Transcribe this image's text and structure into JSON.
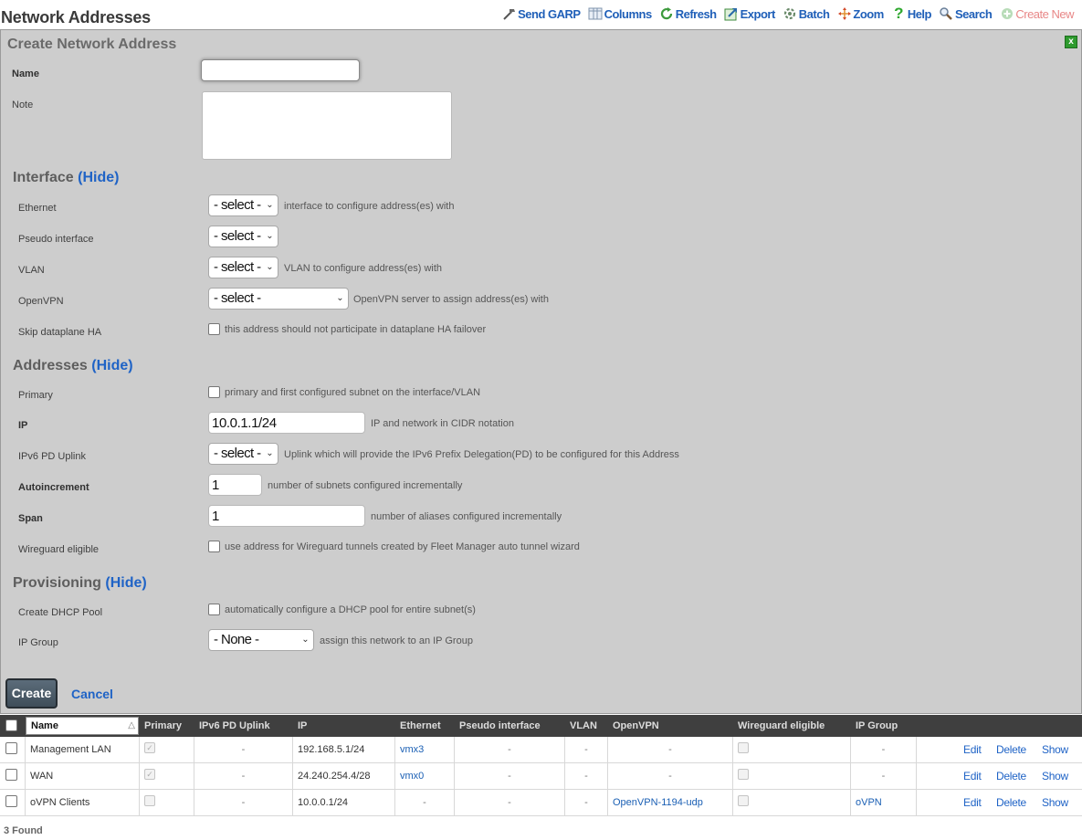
{
  "page": {
    "title": "Network Addresses"
  },
  "toolbar": [
    {
      "key": "send-garp",
      "label": "Send GARP",
      "icon": "hammer-icon",
      "enabled": true
    },
    {
      "key": "columns",
      "label": "Columns",
      "icon": "columns-icon",
      "enabled": true
    },
    {
      "key": "refresh",
      "label": "Refresh",
      "icon": "refresh-icon",
      "enabled": true
    },
    {
      "key": "export",
      "label": "Export",
      "icon": "export-icon",
      "enabled": true
    },
    {
      "key": "batch",
      "label": "Batch",
      "icon": "batch-icon",
      "enabled": true
    },
    {
      "key": "zoom",
      "label": "Zoom",
      "icon": "zoom-icon",
      "enabled": true
    },
    {
      "key": "help",
      "label": "Help",
      "icon": "help-icon",
      "enabled": true
    },
    {
      "key": "search",
      "label": "Search",
      "icon": "search-icon",
      "enabled": true
    },
    {
      "key": "create-new",
      "label": "Create New",
      "icon": "plus-icon",
      "enabled": false
    }
  ],
  "form": {
    "title": "Create Network Address",
    "close_label": "x",
    "name": {
      "label": "Name",
      "value": ""
    },
    "note": {
      "label": "Note",
      "value": ""
    },
    "hide_label": "(Hide)",
    "interface": {
      "title": "Interface",
      "ethernet": {
        "label": "Ethernet",
        "value": "- select -",
        "hint": "interface to configure address(es) with"
      },
      "pseudo": {
        "label": "Pseudo interface",
        "value": "- select -"
      },
      "vlan": {
        "label": "VLAN",
        "value": "- select -",
        "hint": "VLAN to configure address(es) with"
      },
      "openvpn": {
        "label": "OpenVPN",
        "value": "- select -",
        "hint": "OpenVPN server to assign address(es) with"
      },
      "skip_ha": {
        "label": "Skip dataplane HA",
        "hint": "this address should not participate in dataplane HA failover"
      }
    },
    "addresses": {
      "title": "Addresses",
      "primary": {
        "label": "Primary",
        "hint": "primary and first configured subnet on the interface/VLAN"
      },
      "ip": {
        "label": "IP",
        "value": "10.0.1.1/24",
        "hint": "IP and network in CIDR notation"
      },
      "ipv6_pd": {
        "label": "IPv6 PD Uplink",
        "value": "- select -",
        "hint": "Uplink which will provide the IPv6 Prefix Delegation(PD) to be configured for this Address"
      },
      "autoincrement": {
        "label": "Autoincrement",
        "value": "1",
        "hint": "number of subnets configured incrementally"
      },
      "span": {
        "label": "Span",
        "value": "1",
        "hint": "number of aliases configured incrementally"
      },
      "wireguard": {
        "label": "Wireguard eligible",
        "hint": "use address for Wireguard tunnels created by Fleet Manager auto tunnel wizard"
      }
    },
    "provisioning": {
      "title": "Provisioning",
      "dhcp": {
        "label": "Create DHCP Pool",
        "hint": "automatically configure a DHCP pool for entire subnet(s)"
      },
      "ip_group": {
        "label": "IP Group",
        "value": "- None -",
        "hint": "assign this network to an IP Group"
      }
    },
    "create_label": "Create",
    "cancel_label": "Cancel"
  },
  "table": {
    "columns": [
      "Name",
      "Primary",
      "IPv6 PD Uplink",
      "IP",
      "Ethernet",
      "Pseudo interface",
      "VLAN",
      "OpenVPN",
      "Wireguard eligible",
      "IP Group"
    ],
    "actions": [
      "Edit",
      "Delete",
      "Show"
    ],
    "rows": [
      {
        "name": "Management LAN",
        "primary": true,
        "ipv6": "-",
        "ip": "192.168.5.1/24",
        "ethernet": "vmx3",
        "pseudo": "-",
        "vlan": "-",
        "openvpn": "-",
        "wireguard": false,
        "ip_group": "-"
      },
      {
        "name": "WAN",
        "primary": true,
        "ipv6": "-",
        "ip": "24.240.254.4/28",
        "ethernet": "vmx0",
        "pseudo": "-",
        "vlan": "-",
        "openvpn": "-",
        "wireguard": false,
        "ip_group": "-"
      },
      {
        "name": "oVPN Clients",
        "primary": false,
        "ipv6": "-",
        "ip": "10.0.0.1/24",
        "ethernet": "-",
        "pseudo": "-",
        "vlan": "-",
        "openvpn": "OpenVPN-1194-udp",
        "wireguard": false,
        "ip_group": "oVPN"
      }
    ],
    "found_label": "3 Found"
  },
  "colors": {
    "accent": "#1f63c6",
    "panel": "#cdcdcd",
    "header": "#3f3f3f",
    "disabled": "#e88787"
  }
}
